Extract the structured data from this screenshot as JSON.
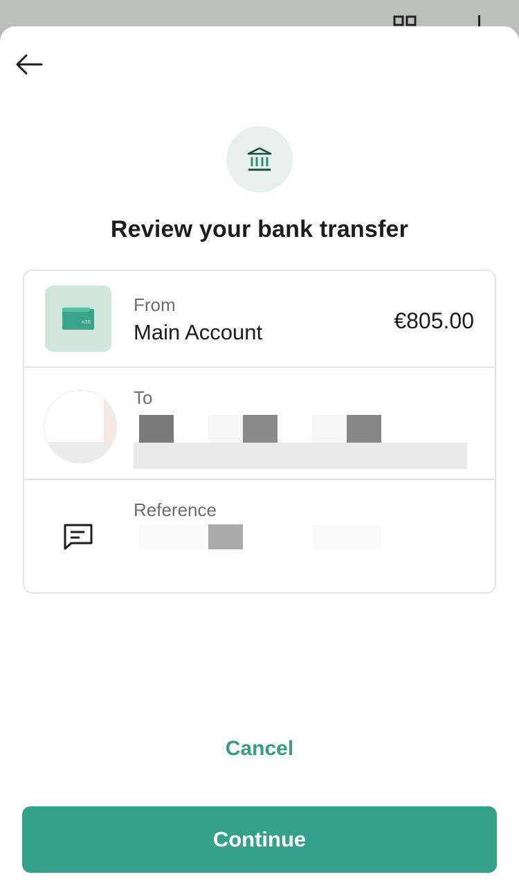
{
  "header": {
    "back_icon": "arrow-left-icon"
  },
  "hero": {
    "icon": "bank-icon",
    "title": "Review your bank transfer"
  },
  "from": {
    "label": "From",
    "account": "Main Account",
    "amount": "€805.00",
    "icon": "wallet-icon"
  },
  "to": {
    "label": "To",
    "avatar_icon": "recipient-avatar"
  },
  "reference": {
    "label": "Reference",
    "icon": "message-icon"
  },
  "actions": {
    "cancel_label": "Cancel",
    "continue_label": "Continue"
  },
  "colors": {
    "accent": "#36a18a",
    "accent_text": "#3a9a84",
    "tile": "#cfe6dd",
    "circle": "#e6f1ed"
  }
}
